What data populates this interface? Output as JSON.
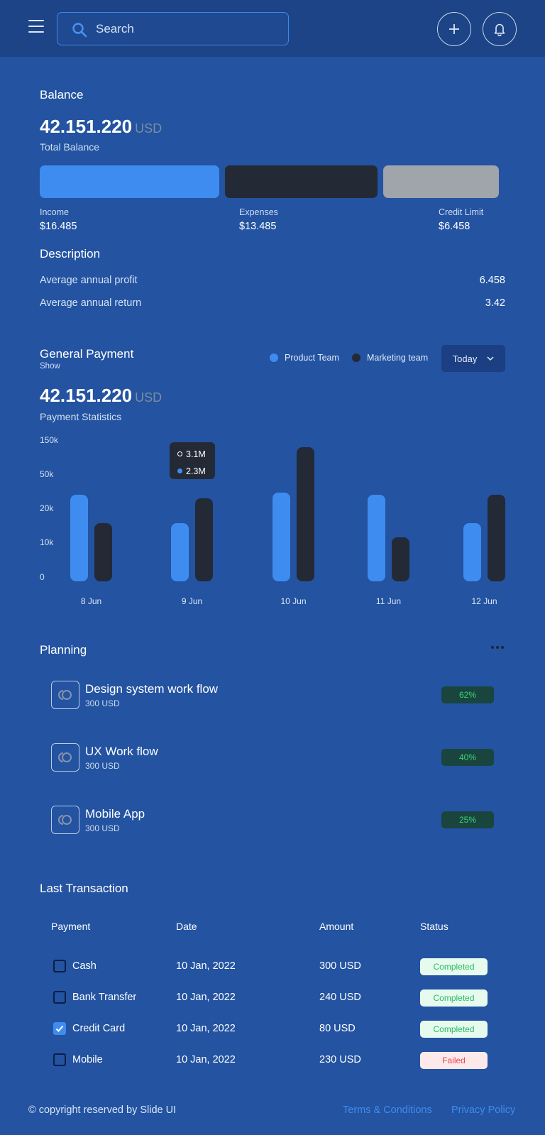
{
  "header": {
    "search_placeholder": "Search",
    "add_icon": "plus-icon",
    "notification_icon": "bell-icon",
    "menu_icon": "hamburger-icon"
  },
  "balance": {
    "title": "Balance",
    "amount": "42.151.220",
    "currency": "USD",
    "subtitle": "Total Balance",
    "breakdown": [
      {
        "label": "Income",
        "value": "$16.485",
        "color": "#3f8cf0"
      },
      {
        "label": "Expenses",
        "value": "$13.485",
        "color": "#232a36"
      },
      {
        "label": "Credit Limit",
        "value": "$6.458",
        "color": "#a0a4ab"
      }
    ]
  },
  "description": {
    "title": "Description",
    "rows": [
      {
        "label": "Average annual profit",
        "value": "6.458"
      },
      {
        "label": "Average annual return",
        "value": "3.42"
      }
    ]
  },
  "payment": {
    "title": "General Payment",
    "show_label": "Show",
    "amount": "42.151.220",
    "currency": "USD",
    "subtitle": "Payment Statistics",
    "legend": [
      {
        "label": "Product Team",
        "color": "#3f8cf0"
      },
      {
        "label": "Marketing team",
        "color": "#232a36"
      }
    ],
    "period": "Today",
    "tooltip": {
      "first": "3.1M",
      "second": "2.3M"
    }
  },
  "chart_data": {
    "type": "bar",
    "title": "Payment Statistics",
    "categories": [
      "8 Jun",
      "9 Jun",
      "10 Jun",
      "11 Jun",
      "12 Jun"
    ],
    "y_ticks": [
      "150k",
      "50k",
      "20k",
      "10k",
      "0"
    ],
    "series": [
      {
        "name": "Product Team",
        "color": "#3f8cf0",
        "values": [
          36,
          17,
          38,
          36,
          17
        ]
      },
      {
        "name": "Marketing team",
        "color": "#232a36",
        "values": [
          17,
          33,
          143,
          13,
          36
        ]
      }
    ],
    "legend": "top-right",
    "grid": false
  },
  "planning": {
    "title": "Planning",
    "items": [
      {
        "title": "Design system work flow",
        "amount": "300 USD",
        "percent": "62%"
      },
      {
        "title": "UX Work flow",
        "amount": "300 USD",
        "percent": "40%"
      },
      {
        "title": "Mobile App",
        "amount": "300 USD",
        "percent": "25%"
      }
    ]
  },
  "transactions": {
    "title": "Last Transaction",
    "columns": [
      "Payment",
      "Date",
      "Amount",
      "Status"
    ],
    "rows": [
      {
        "payment": "Cash",
        "date": "10 Jan, 2022",
        "amount": "300 USD",
        "status": "Completed",
        "checked": false
      },
      {
        "payment": "Bank Transfer",
        "date": "10 Jan, 2022",
        "amount": "240 USD",
        "status": "Completed",
        "checked": false
      },
      {
        "payment": "Credit Card",
        "date": "10 Jan, 2022",
        "amount": "80 USD",
        "status": "Completed",
        "checked": true
      },
      {
        "payment": "Mobile",
        "date": "10 Jan, 2022",
        "amount": "230 USD",
        "status": "Failed",
        "checked": false
      }
    ]
  },
  "footer": {
    "copyright": "© copyright reserved by Slide UI",
    "terms": "Terms & Conditions",
    "privacy": "Privacy Policy"
  }
}
